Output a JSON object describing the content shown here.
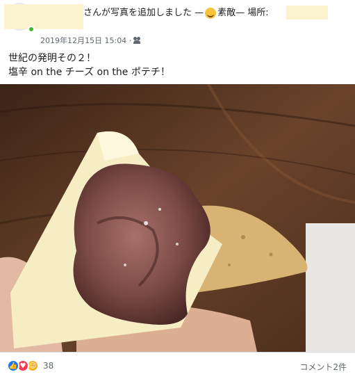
{
  "header": {
    "action_text": "さんが写真を追加しました — ",
    "feeling": "素敵",
    "location_prefix": " — 場所:",
    "feeling_icon": "smiling-face-icon"
  },
  "meta": {
    "date": "2019年12月15日 15:04 ·",
    "audience_icon": "friends-icon"
  },
  "post": {
    "line1": "世紀の発明その２！",
    "line2": "塩辛 on the チーズ on the ポテチ！"
  },
  "footer": {
    "reaction_icons": [
      "like-icon",
      "love-icon",
      "haha-icon"
    ],
    "reaction_count": "38",
    "comments": "コメント2件"
  },
  "colors": {
    "like": "#1877f2",
    "love": "#f33e58",
    "haha": "#f7b125",
    "meta": "#606770",
    "redaction": "#fbf2cf"
  }
}
